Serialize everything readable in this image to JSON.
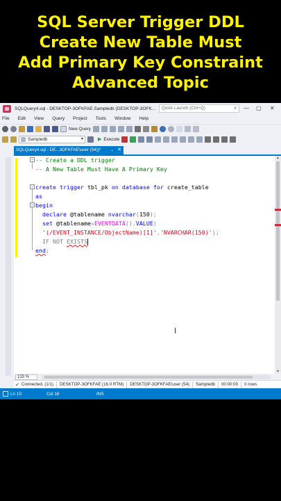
{
  "banner": {
    "lines": [
      "SQL Server Trigger DDL",
      "Create New Table Must",
      "Add Primary Key Constraint",
      "Advanced Topic"
    ],
    "color": "#fff200"
  },
  "window": {
    "title": "SQLQuery4.sql - DESKTOP-3OFKFAE.Sampledb (DESKTOP-3OFK...",
    "quick_launch_placeholder": "Quick Launch (Ctrl+Q)"
  },
  "menu": [
    "File",
    "Edit",
    "View",
    "Query",
    "Project",
    "Tools",
    "Window",
    "Help"
  ],
  "toolbar": {
    "new_query": "New Query"
  },
  "toolbar2": {
    "database": "Sampledb",
    "execute": "Execute"
  },
  "tab": {
    "label": "SQLQuery4.sql - DE...3OFKFAE\\user (54))*",
    "pin": "→",
    "close": "✕"
  },
  "code_lines": [
    "-- Create a DDL trigger",
    "-- A New Table Must Have A Primary Key",
    "",
    "create trigger tbl_pk on database for create_table",
    "as",
    "begin",
    "  declare @tablename nvarchar(150);",
    "  set @tablename=EVENTDATA().VALUE(",
    "  '(/EVENT_INSTANCE/ObjectName)[1]','NVARCHAR(150)');",
    "  IF NOT EXISTS",
    "end;"
  ],
  "zoom": "133 %",
  "results_bar": {
    "status": "Connected. (1/1)",
    "server": "DESKTOP-3OFKFAE (16.0 RTM)",
    "user": "DESKTOP-3OFKFAE\\user (54)",
    "database": "Sampledb",
    "time": "00:00:00",
    "rows": "0 rows"
  },
  "status_bar": {
    "line": "Ln 10",
    "col": "Col 16",
    "mode": "INS"
  },
  "colors": {
    "accent": "#007acc",
    "keyword": "#0000ff",
    "comment": "#008000",
    "string": "#e0001b",
    "function": "#ff00ff"
  }
}
